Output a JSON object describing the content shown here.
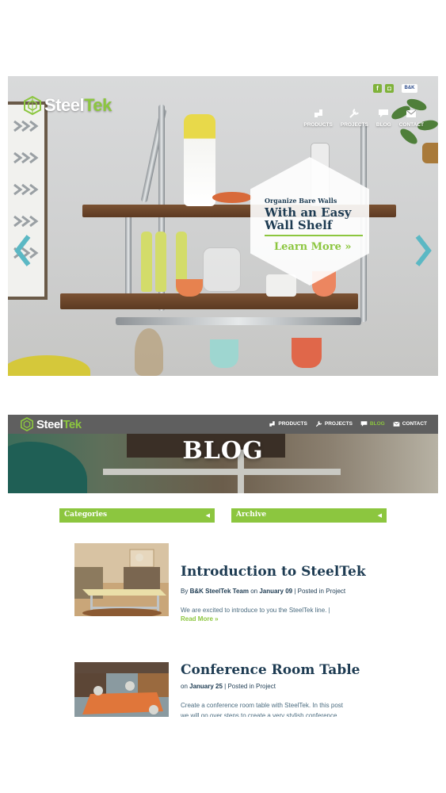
{
  "brand": {
    "name_part1": "Steel",
    "name_part2": "Tek",
    "green": "#8cc63f",
    "navy": "#1d3b52"
  },
  "hero": {
    "social": [
      {
        "name": "facebook-icon",
        "glyph": "f"
      },
      {
        "name": "instagram-icon",
        "glyph": "◘"
      },
      {
        "name": "bk-logo-icon",
        "glyph": "B&K"
      }
    ],
    "nav": [
      {
        "label": "PRODUCTS",
        "icon": "pipe-fitting-icon"
      },
      {
        "label": "PROJECTS",
        "icon": "wrench-icon"
      },
      {
        "label": "BLOG",
        "icon": "speech-bubble-icon"
      },
      {
        "label": "CONTACT",
        "icon": "envelope-icon"
      }
    ],
    "promo": {
      "eyebrow": "Organize Bare Walls",
      "title": "With an Easy Wall Shelf",
      "cta": "Learn More »"
    }
  },
  "blog": {
    "nav": [
      {
        "label": "PRODUCTS",
        "icon": "pipe-fitting-icon"
      },
      {
        "label": "PROJECTS",
        "icon": "wrench-icon"
      },
      {
        "label": "BLOG",
        "icon": "speech-bubble-icon"
      },
      {
        "label": "CONTACT",
        "icon": "envelope-icon"
      }
    ],
    "banner_title": "BLOG",
    "filters": {
      "categories": "Categories",
      "archive": "Archive"
    },
    "posts": [
      {
        "title": "Introduction to SteelTek",
        "meta_by": "By ",
        "author": "B&K SteelTek Team",
        "meta_on": " on ",
        "date": "January 09",
        "meta_posted": " | Posted in Project",
        "excerpt": "We are excited to introduce to you the SteelTek line. |",
        "more": "Read More »"
      },
      {
        "title": "Conference Room Table",
        "meta_on": "on ",
        "date": "January 25",
        "meta_posted": " | Posted in Project",
        "excerpt": "Create a conference room table with SteelTek. In this post we will go over steps to create a very stylish conference"
      }
    ]
  }
}
